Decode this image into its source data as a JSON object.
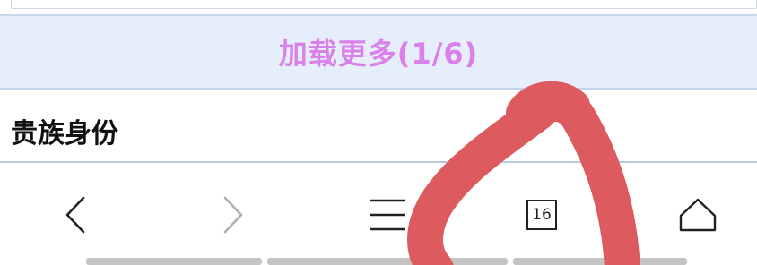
{
  "load_more": {
    "label": "加载更多(1/6)"
  },
  "section": {
    "title": "贵族身份"
  },
  "toolbar": {
    "tabs_count": "16",
    "icons": [
      "back-icon",
      "forward-icon",
      "menu-icon",
      "tabs-icon",
      "home-icon"
    ]
  },
  "colors": {
    "load_more_bg": "#e6eefb",
    "load_more_text": "#d980ea",
    "doodle": "#dd5a5f"
  }
}
